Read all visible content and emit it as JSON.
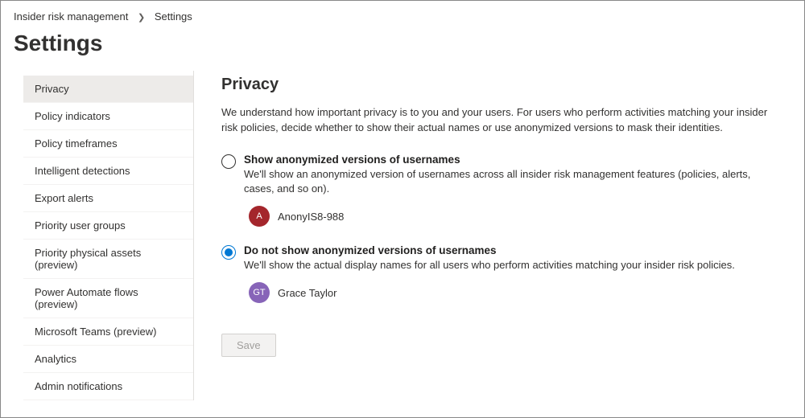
{
  "breadcrumb": {
    "root": "Insider risk management",
    "current": "Settings"
  },
  "page_title": "Settings",
  "sidebar": {
    "items": [
      {
        "label": "Privacy",
        "active": true
      },
      {
        "label": "Policy indicators"
      },
      {
        "label": "Policy timeframes"
      },
      {
        "label": "Intelligent detections"
      },
      {
        "label": "Export alerts"
      },
      {
        "label": "Priority user groups"
      },
      {
        "label": "Priority physical assets (preview)"
      },
      {
        "label": "Power Automate flows (preview)"
      },
      {
        "label": "Microsoft Teams (preview)"
      },
      {
        "label": "Analytics"
      },
      {
        "label": "Admin notifications"
      }
    ]
  },
  "main": {
    "section_title": "Privacy",
    "intro": "We understand how important privacy is to you and your users. For users who perform activities matching your insider risk policies, decide whether to show their actual names or use anonymized versions to mask their identities.",
    "options": [
      {
        "title": "Show anonymized versions of usernames",
        "desc": "We'll show an anonymized version of usernames across all insider risk management features (policies, alerts, cases, and so on).",
        "avatar_initials": "A",
        "avatar_color": "red",
        "avatar_name": "AnonyIS8-988",
        "selected": false
      },
      {
        "title": "Do not show anonymized versions of usernames",
        "desc": "We'll show the actual display names for all users who perform activities matching your insider risk policies.",
        "avatar_initials": "GT",
        "avatar_color": "purple",
        "avatar_name": "Grace Taylor",
        "selected": true
      }
    ],
    "save_label": "Save"
  }
}
